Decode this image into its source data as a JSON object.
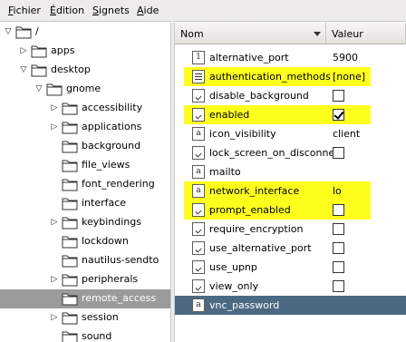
{
  "menubar": {
    "items": [
      {
        "label": "Fichier",
        "u": "F",
        "rest": "ichier"
      },
      {
        "label": "Édition",
        "u": "É",
        "rest": "dition"
      },
      {
        "label": "Signets",
        "u": "S",
        "rest": "ignets"
      },
      {
        "label": "Aide",
        "u": "A",
        "rest": "ide"
      }
    ]
  },
  "tree": {
    "nodes": [
      {
        "label": "/",
        "expander": "expanded"
      },
      {
        "label": "apps",
        "expander": "collapsed"
      },
      {
        "label": "desktop",
        "expander": "expanded"
      },
      {
        "label": "gnome",
        "expander": "expanded"
      },
      {
        "label": "accessibility",
        "expander": "collapsed"
      },
      {
        "label": "applications",
        "expander": "collapsed"
      },
      {
        "label": "background",
        "expander": "none"
      },
      {
        "label": "file_views",
        "expander": "none"
      },
      {
        "label": "font_rendering",
        "expander": "none"
      },
      {
        "label": "interface",
        "expander": "none"
      },
      {
        "label": "keybindings",
        "expander": "collapsed"
      },
      {
        "label": "lockdown",
        "expander": "none"
      },
      {
        "label": "nautilus-sendto",
        "expander": "none"
      },
      {
        "label": "peripherals",
        "expander": "collapsed"
      },
      {
        "label": "remote_access",
        "expander": "none",
        "selected": true
      },
      {
        "label": "session",
        "expander": "collapsed"
      },
      {
        "label": "sound",
        "expander": "none"
      }
    ]
  },
  "table": {
    "columns": {
      "name": "Nom",
      "value": "Valeur"
    },
    "rows": [
      {
        "type": "int",
        "icon_text": "1",
        "name": "alternative_port",
        "value": "5900"
      },
      {
        "type": "list",
        "icon_text": "",
        "name": "authentication_methods",
        "value": "[none]",
        "highlight": true
      },
      {
        "type": "bool",
        "icon_text": "",
        "name": "disable_background",
        "checkbox": false
      },
      {
        "type": "bool",
        "icon_text": "",
        "name": "enabled",
        "checkbox": true,
        "highlight": true
      },
      {
        "type": "string",
        "icon_text": "a",
        "name": "icon_visibility",
        "value": "client"
      },
      {
        "type": "bool",
        "icon_text": "",
        "name": "lock_screen_on_disconnect",
        "checkbox": false
      },
      {
        "type": "string",
        "icon_text": "a",
        "name": "mailto",
        "value": ""
      },
      {
        "type": "string",
        "icon_text": "a",
        "name": "network_interface",
        "value": "lo",
        "highlight": true
      },
      {
        "type": "bool",
        "icon_text": "",
        "name": "prompt_enabled",
        "checkbox": false,
        "highlight": true
      },
      {
        "type": "bool",
        "icon_text": "",
        "name": "require_encryption",
        "checkbox": false
      },
      {
        "type": "bool",
        "icon_text": "",
        "name": "use_alternative_port",
        "checkbox": false
      },
      {
        "type": "bool",
        "icon_text": "",
        "name": "use_upnp",
        "checkbox": false
      },
      {
        "type": "bool",
        "icon_text": "",
        "name": "view_only",
        "checkbox": false
      },
      {
        "type": "string",
        "icon_text": "a",
        "name": "vnc_password",
        "value": "",
        "selected": true
      }
    ]
  },
  "colors": {
    "highlight": "#ffff1e",
    "selection_right": "#4b6983",
    "selection_left": "#9b9b9b"
  }
}
